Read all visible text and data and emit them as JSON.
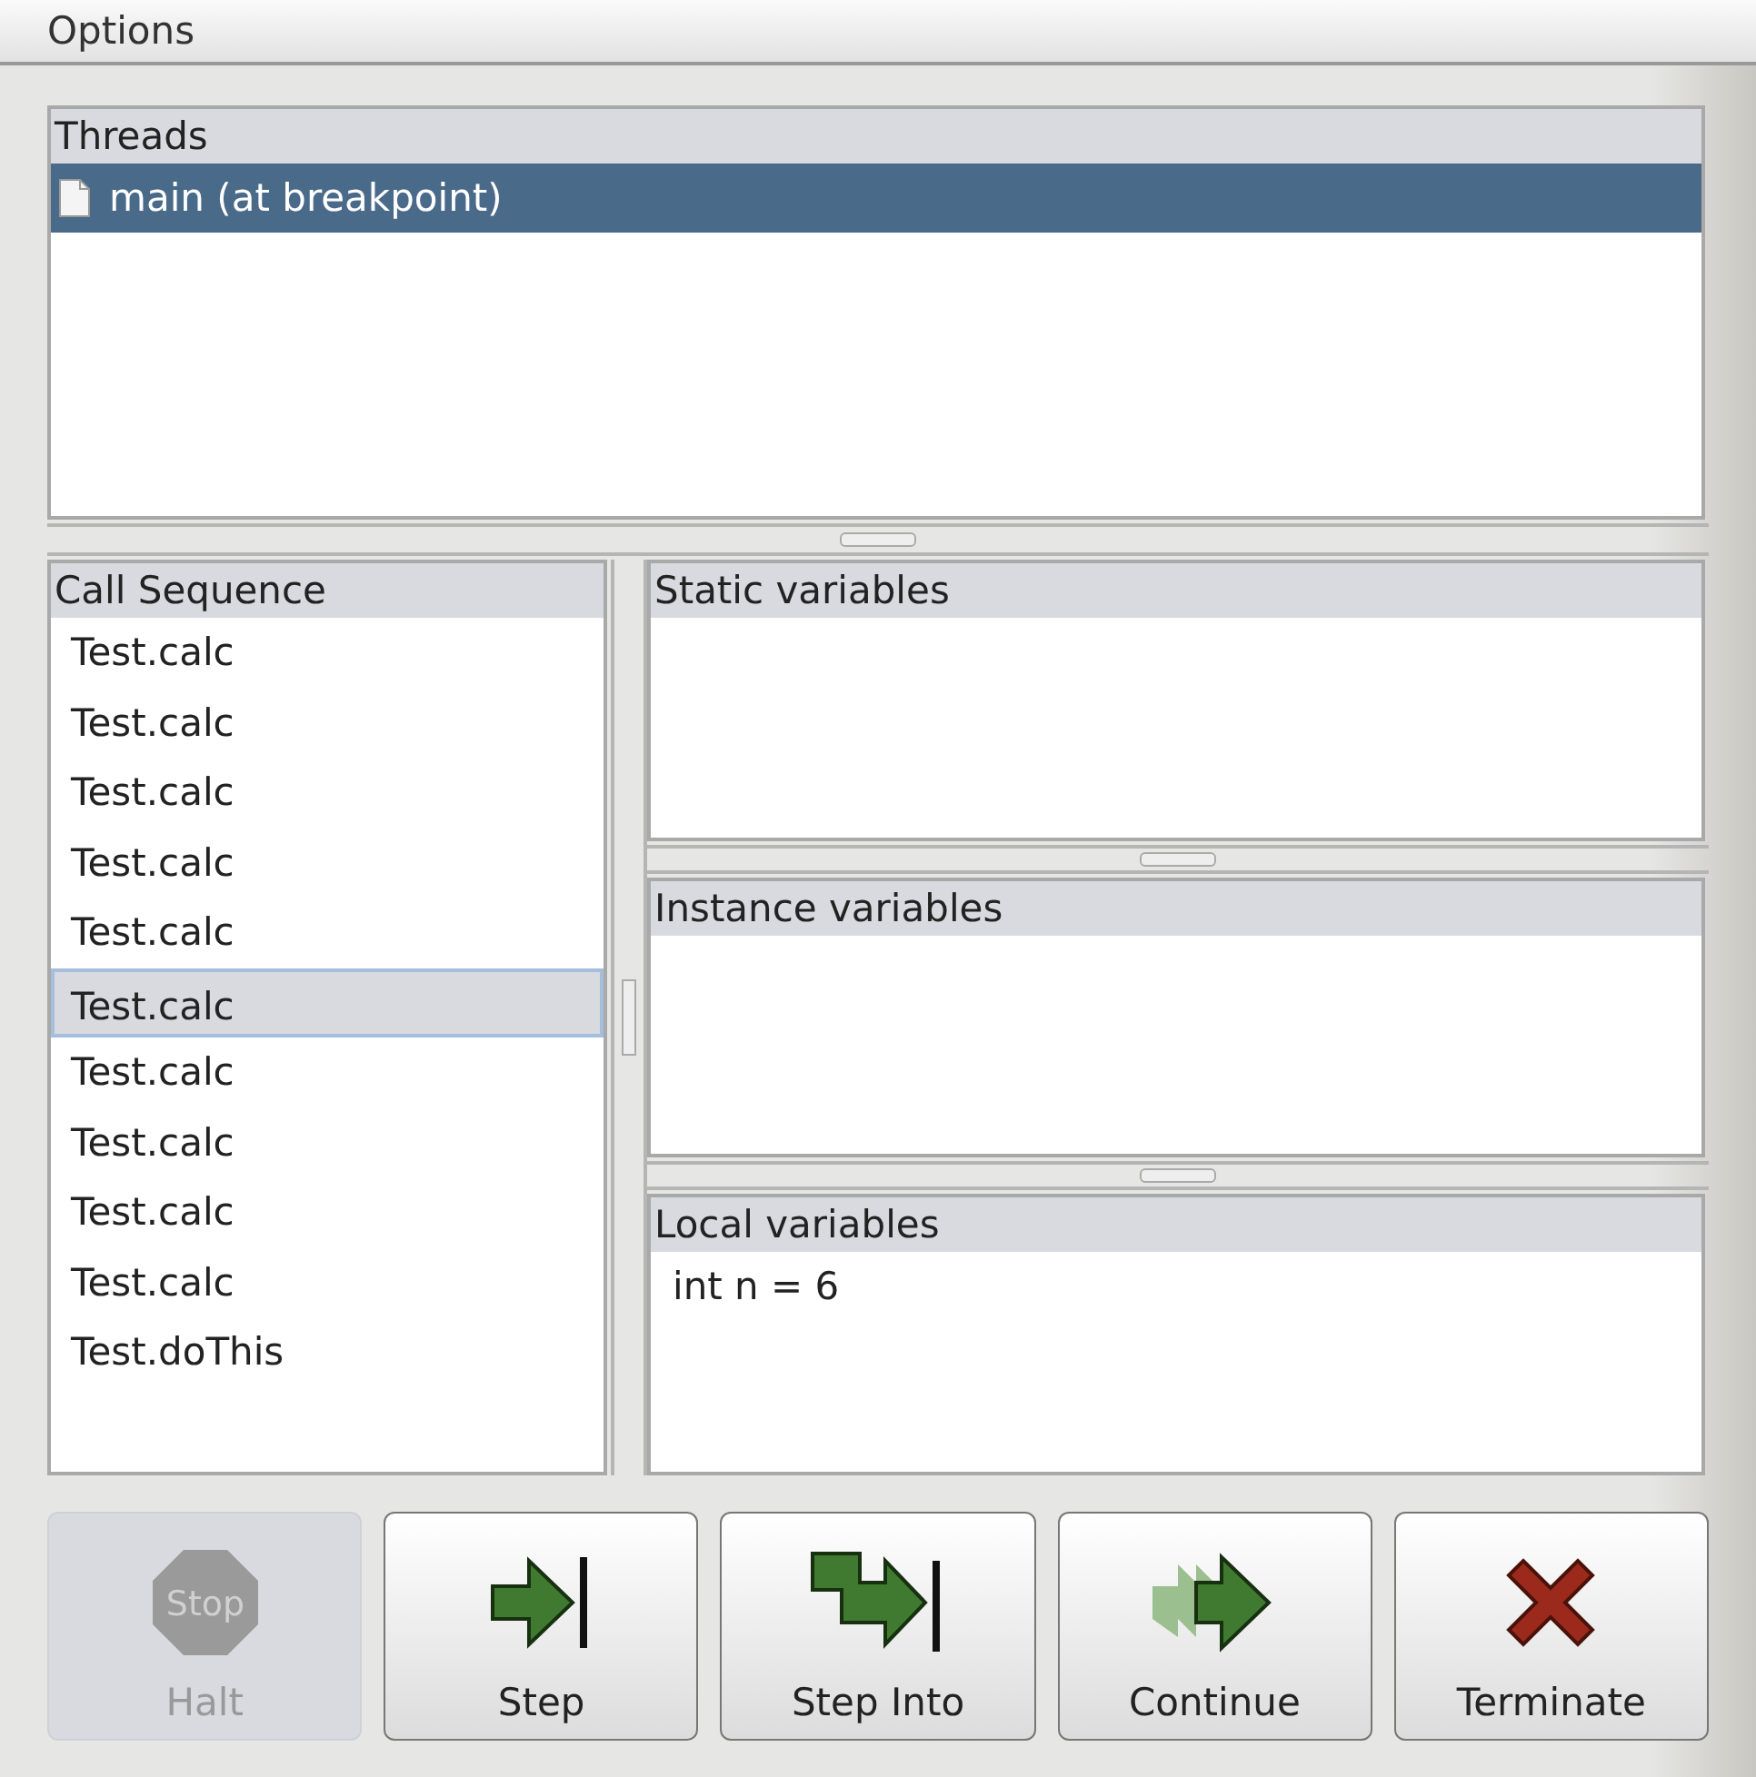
{
  "menu_bar": [
    {
      "label": "Options"
    }
  ],
  "threads": {
    "title": "Threads",
    "items": [
      {
        "label": "main (at breakpoint)",
        "selected": true
      }
    ]
  },
  "call_sequence": {
    "title": "Call Sequence",
    "items": [
      {
        "label": "Test.calc",
        "selected": false
      },
      {
        "label": "Test.calc",
        "selected": false
      },
      {
        "label": "Test.calc",
        "selected": false
      },
      {
        "label": "Test.calc",
        "selected": false
      },
      {
        "label": "Test.calc",
        "selected": false
      },
      {
        "label": "Test.calc",
        "selected": true
      },
      {
        "label": "Test.calc",
        "selected": false
      },
      {
        "label": "Test.calc",
        "selected": false
      },
      {
        "label": "Test.calc",
        "selected": false
      },
      {
        "label": "Test.calc",
        "selected": false
      },
      {
        "label": "Test.doThis",
        "selected": false
      }
    ]
  },
  "variable_panels": [
    {
      "title": "Static variables"
    },
    {
      "title": "Instance variables"
    },
    {
      "title": "Local variables",
      "items": [
        "int n = 6"
      ]
    }
  ],
  "buttons": [
    {
      "kind": "halt",
      "label": "Halt",
      "icon_label": "Stop",
      "disabled": true
    },
    {
      "kind": "step",
      "label": "Step",
      "disabled": false
    },
    {
      "kind": "step-into",
      "label": "Step Into",
      "disabled": false
    },
    {
      "kind": "continue",
      "label": "Continue",
      "disabled": false
    },
    {
      "kind": "terminate",
      "label": "Terminate",
      "disabled": false
    }
  ]
}
